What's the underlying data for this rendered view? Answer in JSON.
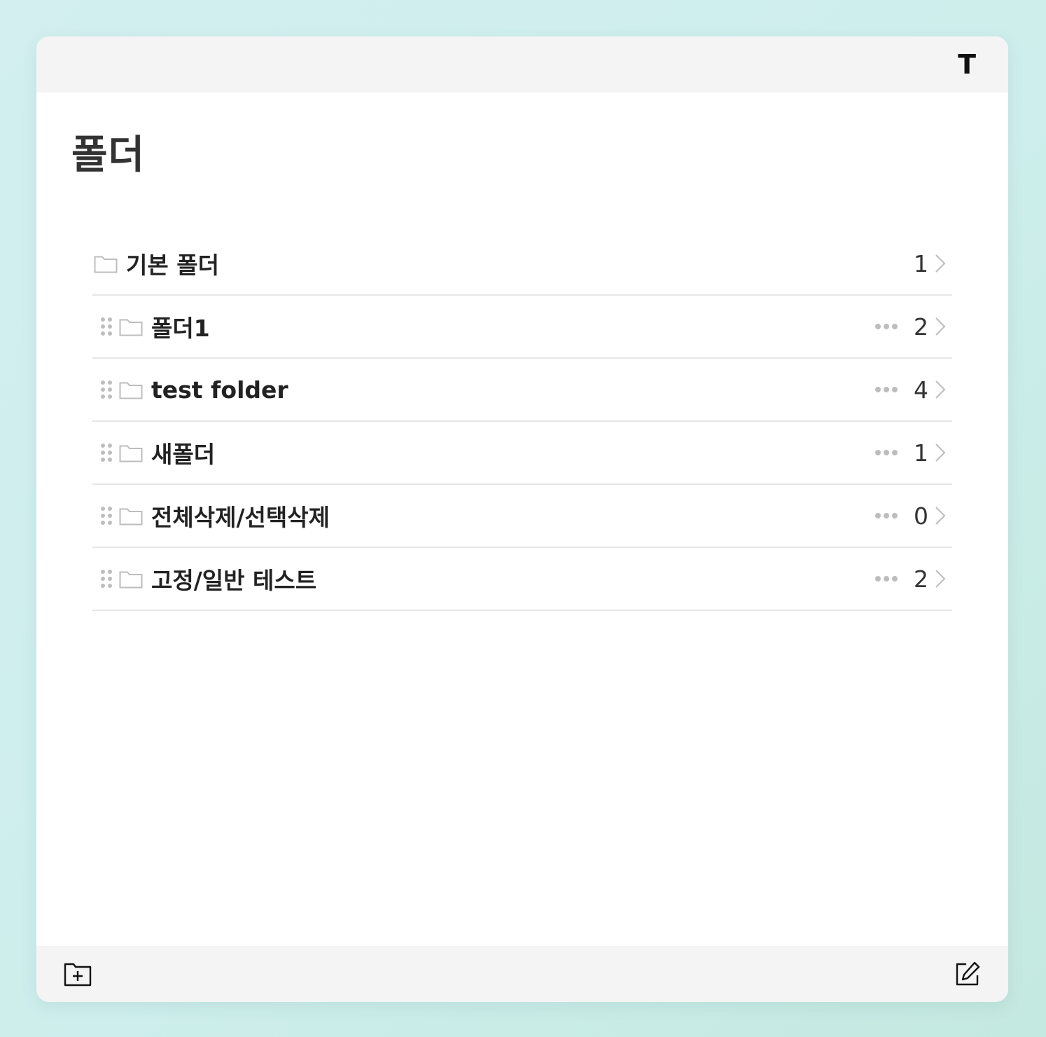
{
  "header": {
    "profile_initial": "T"
  },
  "page": {
    "title": "폴더"
  },
  "folders": [
    {
      "name": "기본 폴더",
      "count": "1"
    },
    {
      "name": "폴더1",
      "count": "2"
    },
    {
      "name": "test folder",
      "count": "4"
    },
    {
      "name": "새폴더",
      "count": "1"
    },
    {
      "name": "전체삭제/선택삭제",
      "count": "0"
    },
    {
      "name": "고정/일반 테스트",
      "count": "2"
    }
  ],
  "icons": {
    "drag_handle": "grip-dots-icon",
    "folder": "folder-outline-icon",
    "more": "more-horizontal-icon",
    "chevron": "chevron-right-icon",
    "new_folder": "folder-plus-icon",
    "compose": "compose-icon"
  },
  "colors": {
    "background": "#cdeeec",
    "bar": "#f4f4f4",
    "text": "#222222",
    "muted_icon": "#bdbdbd"
  }
}
